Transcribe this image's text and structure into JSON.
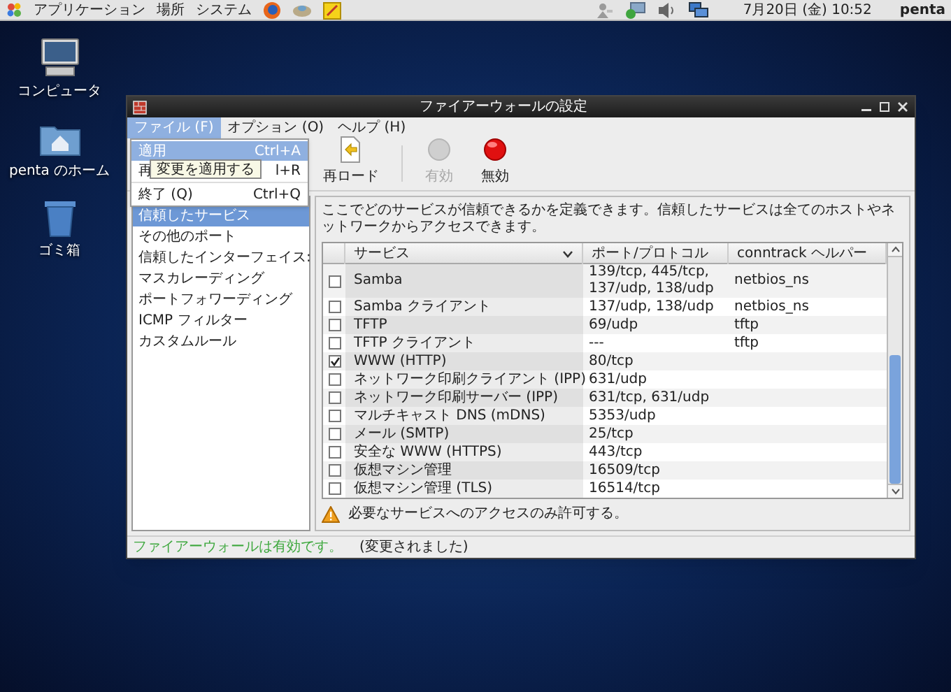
{
  "top_panel": {
    "menus": [
      "アプリケーション",
      "場所",
      "システム"
    ],
    "clock": "7月20日 (金) 10:52",
    "user": "penta"
  },
  "desktop_icons": [
    {
      "kind": "computer",
      "label": "コンピュータ"
    },
    {
      "kind": "home",
      "label": "penta のホーム"
    },
    {
      "kind": "trash",
      "label": "ゴミ箱"
    }
  ],
  "window": {
    "title": "ファイアーウォールの設定",
    "menubar": [
      {
        "label": "ファイル (F)",
        "selected": true
      },
      {
        "label": "オプション (O)",
        "selected": false
      },
      {
        "label": "ヘルプ (H)",
        "selected": false
      }
    ],
    "file_menu": [
      {
        "label": "適用",
        "shortcut": "Ctrl+A",
        "selected": true
      },
      {
        "label": "再",
        "shortcut": "l+R",
        "selected": false
      },
      {
        "label": "終了 (Q)",
        "shortcut": "Ctrl+Q",
        "selected": false
      }
    ],
    "tooltip": "変更を適用する",
    "toolbar": [
      {
        "kind": "reload",
        "label": "再ロード",
        "disabled": false
      },
      {
        "kind": "enable",
        "label": "有効",
        "disabled": true
      },
      {
        "kind": "disable",
        "label": "無効",
        "disabled": false
      }
    ],
    "sidebar": [
      {
        "label": "信頼したサービス",
        "selected": true
      },
      {
        "label": "その他のポート",
        "selected": false
      },
      {
        "label": "信頼したインターフェイス:",
        "selected": false
      },
      {
        "label": "マスカレーディング",
        "selected": false
      },
      {
        "label": "ポートフォワーディング",
        "selected": false
      },
      {
        "label": "ICMP フィルター",
        "selected": false
      },
      {
        "label": "カスタムルール",
        "selected": false
      }
    ],
    "description": "ここでどのサービスが信頼できるかを定義できます。信頼したサービスは全てのホストやネットワークからアクセスできます。",
    "table": {
      "columns": [
        "サービス",
        "ポート/プロトコル",
        "conntrack ヘルパー"
      ],
      "rows": [
        {
          "checked": false,
          "service": "Samba",
          "ports": "139/tcp, 445/tcp, 137/udp, 138/udp",
          "helper": "netbios_ns"
        },
        {
          "checked": false,
          "service": "Samba クライアント",
          "ports": "137/udp, 138/udp",
          "helper": "netbios_ns"
        },
        {
          "checked": false,
          "service": "TFTP",
          "ports": "69/udp",
          "helper": "tftp"
        },
        {
          "checked": false,
          "service": "TFTP クライアント",
          "ports": "---",
          "helper": "tftp"
        },
        {
          "checked": true,
          "service": "WWW (HTTP)",
          "ports": "80/tcp"
        },
        {
          "checked": false,
          "service": "ネットワーク印刷クライアント (IPP)",
          "ports": "631/udp"
        },
        {
          "checked": false,
          "service": "ネットワーク印刷サーバー (IPP)",
          "ports": "631/tcp, 631/udp"
        },
        {
          "checked": false,
          "service": "マルチキャスト DNS (mDNS)",
          "ports": "5353/udp"
        },
        {
          "checked": false,
          "service": "メール (SMTP)",
          "ports": "25/tcp"
        },
        {
          "checked": false,
          "service": "安全な WWW (HTTPS)",
          "ports": "443/tcp"
        },
        {
          "checked": false,
          "service": "仮想マシン管理",
          "ports": "16509/tcp"
        },
        {
          "checked": false,
          "service": "仮想マシン管理 (TLS)",
          "ports": "16514/tcp"
        }
      ]
    },
    "warning": "必要なサービスへのアクセスのみ許可する。",
    "status": {
      "state": "ファイアーウォールは有効です。",
      "note": "(変更されました)"
    }
  }
}
